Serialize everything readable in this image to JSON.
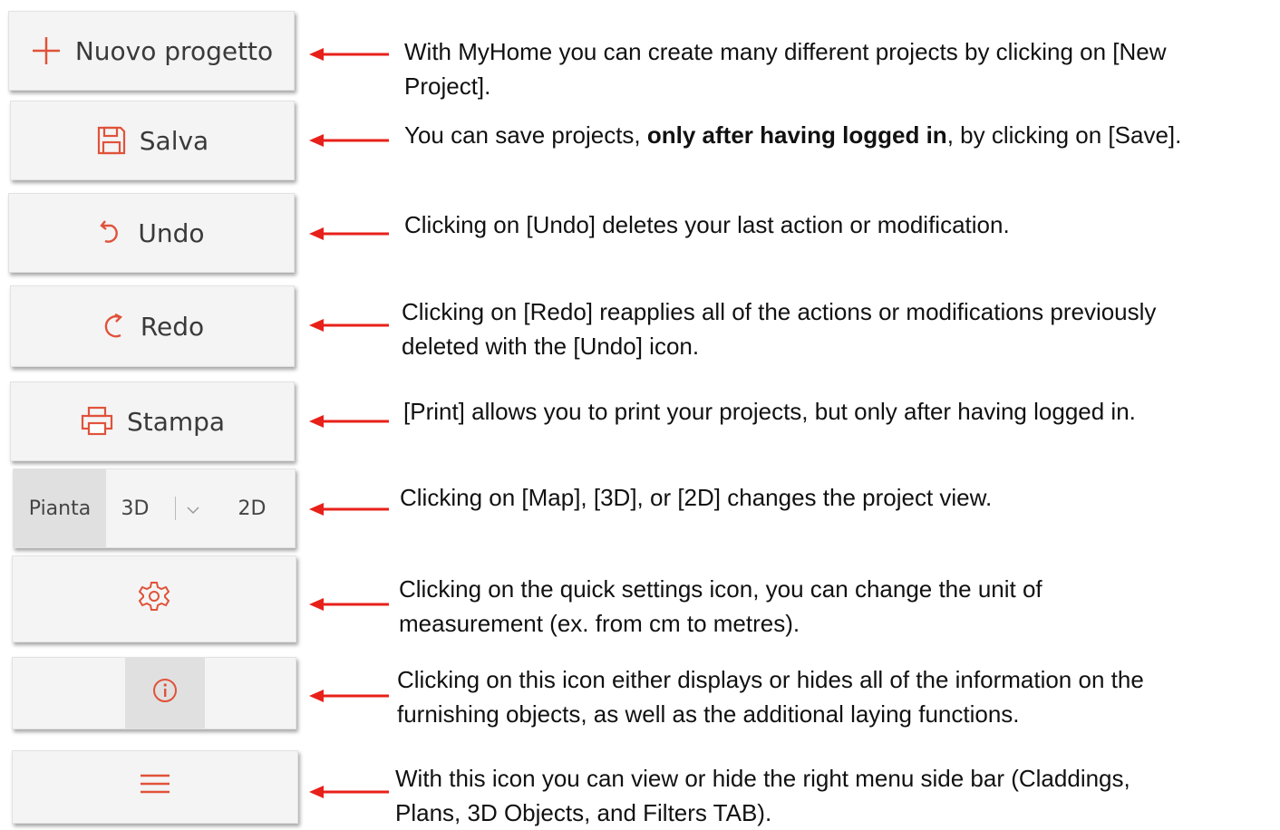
{
  "toolbar": {
    "new_project_label": "Nuovo progetto",
    "save_label": "Salva",
    "undo_label": "Undo",
    "redo_label": "Redo",
    "print_label": "Stampa",
    "view_plan_label": "Pianta",
    "view_3d_label": "3D",
    "view_2d_label": "2D"
  },
  "icons": {
    "new_project": "plus-icon",
    "save": "floppy-disk-icon",
    "undo": "undo-icon",
    "redo": "redo-icon",
    "print": "printer-icon",
    "dropdown": "chevron-down-icon",
    "settings": "gear-icon",
    "info": "info-icon",
    "menu": "hamburger-menu-icon",
    "arrow": "left-arrow-icon"
  },
  "descriptions": {
    "new_project": {
      "line1": "With MyHome you can create many different projects by clicking on [New",
      "line2": "Project]."
    },
    "save": {
      "pre": "You can save projects, ",
      "bold": "only after having logged in",
      "post": ", by clicking on [Save]."
    },
    "undo": "Clicking on [Undo] deletes your last action or modification.",
    "redo": {
      "line1": "Clicking on [Redo] reapplies all of the actions or modifications previously",
      "line2": "deleted with the [Undo] icon."
    },
    "print": "[Print] allows you to print your projects, but only after having logged in.",
    "view": "Clicking on [Map], [3D], or [2D] changes the project view.",
    "settings": {
      "line1": "Clicking on the quick settings icon, you can change the unit of",
      "line2": "measurement (ex. from cm to metres)."
    },
    "info": {
      "line1": "Clicking on this icon either displays or hides all of the information on the",
      "line2": "furnishing objects, as well as the additional laying functions."
    },
    "menu": {
      "line1": "With this icon you can view or hide the right menu side bar (Claddings,",
      "line2": "Plans, 3D Objects, and Filters TAB)."
    }
  },
  "colors": {
    "accent": "#e0523a",
    "arrow": "#e8201a",
    "button_bg": "#f4f4f4",
    "active_bg": "#e0e0e0",
    "text": "#111111"
  }
}
